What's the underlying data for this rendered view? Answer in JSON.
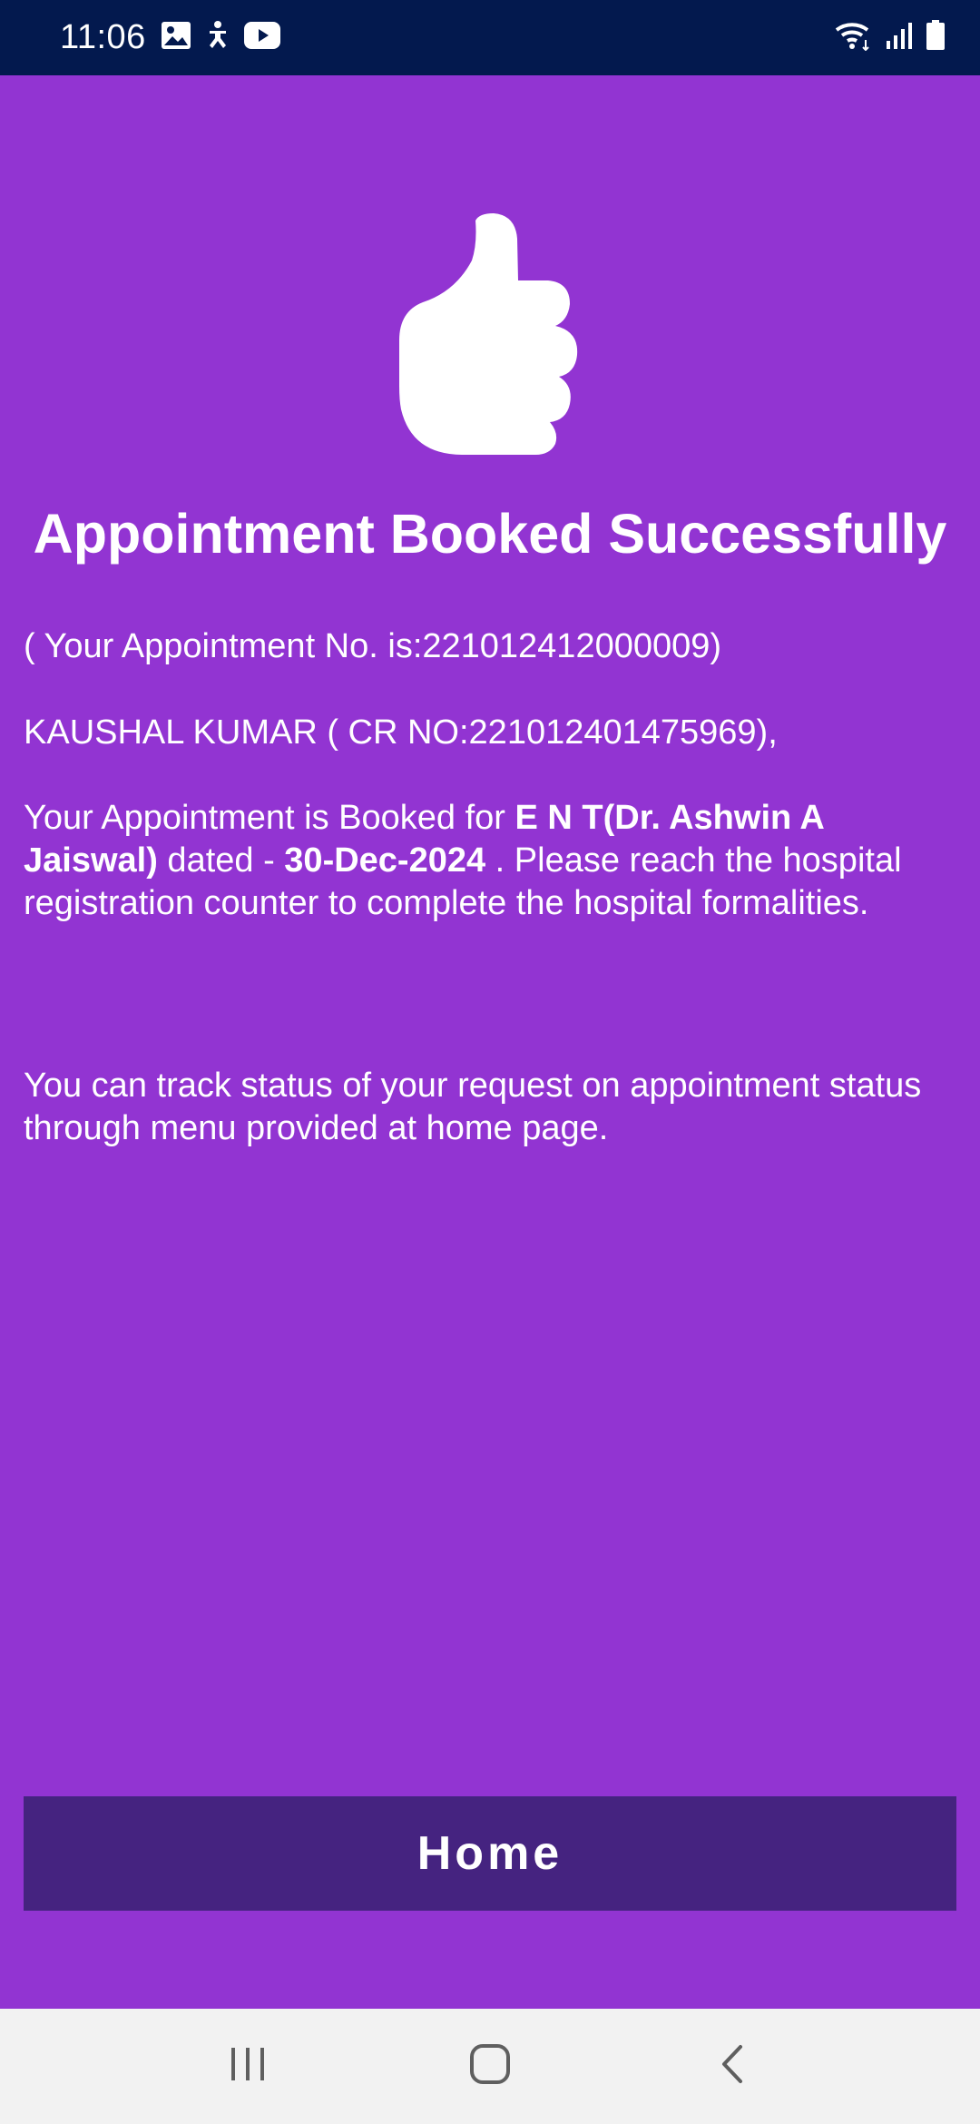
{
  "status_bar": {
    "time": "11:06",
    "left_icons": [
      "gallery-icon",
      "accessibility-icon",
      "youtube-icon"
    ],
    "right_icons": [
      "wifi-icon",
      "signal-icon",
      "battery-icon"
    ]
  },
  "confirmation": {
    "icon": "thumbs-up-icon",
    "title": "Appointment Booked Successfully",
    "appointment_line": "( Your Appointment No. is:221012412000009)",
    "patient_line": "KAUSHAL KUMAR ( CR NO:221012401475969),",
    "booking": {
      "prefix": "Your Appointment is Booked for ",
      "department": "E N T(Dr. Ashwin A Jaiswal)",
      "dated_label": " dated - ",
      "date": "30-Dec-2024",
      "suffix": " . Please reach the hospital registration counter to complete the hospital formalities."
    },
    "tracking_note": "You can track status of your request on appointment status through menu provided at home page."
  },
  "home_button": {
    "label": "Home"
  },
  "nav_bar": {
    "items": [
      "recent-apps-icon",
      "home-icon",
      "back-icon"
    ]
  },
  "colors": {
    "background": "#9234D2",
    "status_bar": "#03194E",
    "button": "#452380",
    "nav_bar": "#F2F2F2",
    "nav_icon": "#5F5F5F"
  }
}
